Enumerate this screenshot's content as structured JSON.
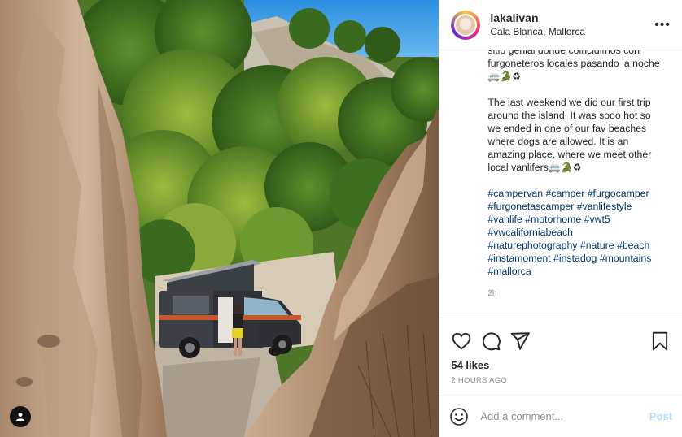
{
  "header": {
    "username": "lakalivan",
    "location": "Cala Blanca, Mallorca",
    "more_label": "•••"
  },
  "caption": {
    "spanish_line1": "sitio genial donde coincidimos con",
    "spanish_line2": "furgoneteros locales pasando la noche",
    "spanish_emojis": "🚐🐊♻",
    "english": [
      "The last weekend we did our first trip",
      "around the island. It was sooo hot so",
      "we ended in one of our fav beaches",
      "where dogs are allowed. It is an",
      "amazing place, where we meet other",
      "local vanlifers"
    ],
    "english_emojis": "🚐🐊♻",
    "hashtags": [
      "#campervan",
      "#camper",
      "#furgocamper",
      "#furgonetascamper",
      "#vanlifestyle",
      "#vanlife",
      "#motorhome",
      "#vwt5",
      "#vwcaliforniabeach",
      "#naturephotography",
      "#nature",
      "#beach",
      "#instamoment",
      "#instadog",
      "#mountains",
      "#mallorca"
    ],
    "age": "2h"
  },
  "actions": {
    "icons": [
      "heart-icon",
      "comment-icon",
      "share-icon",
      "bookmark-icon"
    ],
    "likes": "54 likes",
    "timestamp": "2 HOURS AGO"
  },
  "comment": {
    "placeholder": "Add a comment...",
    "post_label": "Post",
    "icon": "emoji-icon"
  },
  "photo": {
    "tag_icon": "user-tag-icon"
  },
  "colors": {
    "link": "#00376b",
    "muted": "#8e8e8e",
    "post_disabled": "#b2dffc",
    "border": "#efefef"
  }
}
